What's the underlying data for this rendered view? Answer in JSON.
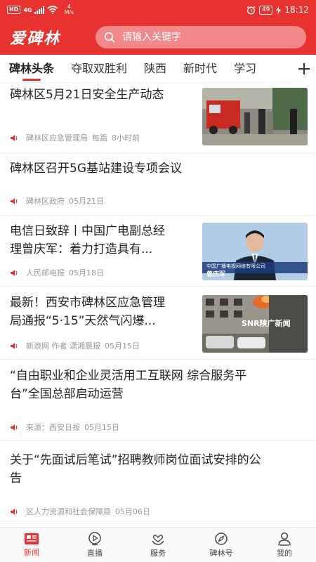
{
  "status_bar": {
    "hd": "HD",
    "network": "4G",
    "speed_value": "4",
    "speed_unit": "M/s",
    "battery": "49",
    "time": "18:12"
  },
  "header": {
    "logo": "爱碑林",
    "search_placeholder": "请输入关键字"
  },
  "tabs": [
    "碑林头条",
    "夺取双胜利",
    "陕西",
    "新时代",
    "学习"
  ],
  "feed": [
    {
      "title_lines": [
        "碑林区5月21日安全生产动态"
      ],
      "source": "碑林区应急管理局",
      "extra": "每篇",
      "time": "8小时前",
      "thumb": "fire-truck-scene"
    },
    {
      "title_lines": [
        "碑林区召开5G基站建设专项会议"
      ],
      "source": "碑林区政府",
      "time": "05月21日"
    },
    {
      "title_lines": [
        "电信日致辞丨中国广电副总经",
        "理曾庆军：着力打造具有..."
      ],
      "source": "人民邮电报",
      "time": "05月18日",
      "thumb": "news-speaker",
      "caption_name": "曾庆军",
      "caption_org": "中国广播电视网络有限公司"
    },
    {
      "title_lines": [
        "最新！西安市碑林区应急管理",
        "局通报“5·15”天然气闪爆..."
      ],
      "source": "新浪网 作者 潇湘晨报",
      "time": "05月15日",
      "thumb": "building-explosion",
      "watermark": "SNR陕广新闻"
    },
    {
      "title_lines": [
        "“自由职业和企业灵活用工互联网 综合服务平",
        "台”全国总部启动运营"
      ],
      "source": "来源：西安日报",
      "time": "05月15日"
    },
    {
      "title_lines": [
        "关于“先面试后笔试”招聘教师岗位面试安排的公",
        "告"
      ],
      "source": "区人力资源和社会保障局",
      "time": "05月06日"
    }
  ],
  "bottom_nav": [
    {
      "label": "新闻",
      "icon": "news-icon",
      "active": true
    },
    {
      "label": "直播",
      "icon": "live-icon"
    },
    {
      "label": "服务",
      "icon": "service-icon"
    },
    {
      "label": "碑林号",
      "icon": "compass-icon"
    },
    {
      "label": "我的",
      "icon": "profile-icon"
    }
  ],
  "colors": {
    "brand_red": "#e8322f",
    "meta_gray": "#999999"
  }
}
